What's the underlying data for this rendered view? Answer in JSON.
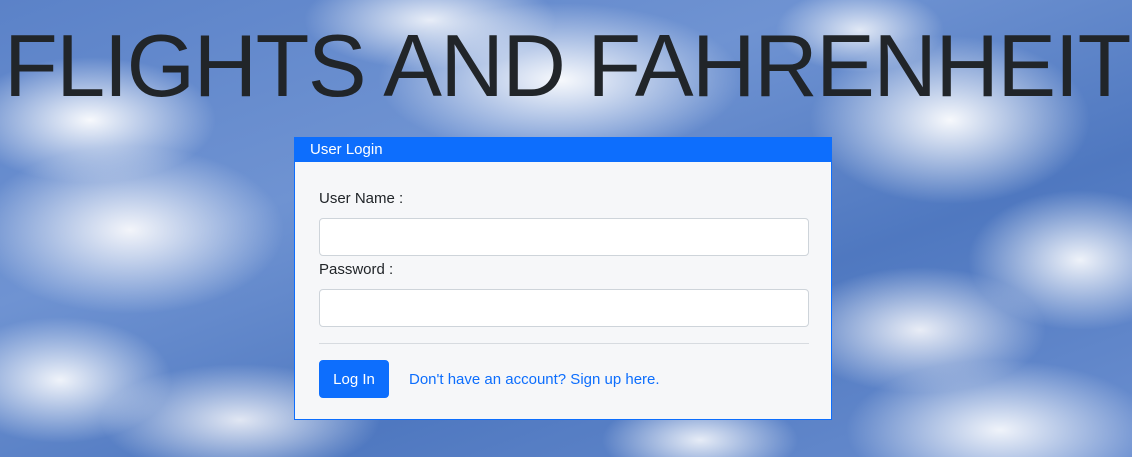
{
  "page": {
    "title": "FLIGHTS AND FAHRENHEIT"
  },
  "login_card": {
    "header": "User Login",
    "username_label": "User Name :",
    "username_value": "",
    "password_label": "Password :",
    "password_value": "",
    "login_button": "Log In",
    "signup_link": "Don't have an account? Sign up here."
  },
  "colors": {
    "accent": "#0d6efd",
    "title_text": "#212529",
    "card_background": "#f6f7f9",
    "sky_background": "#5b82c8"
  }
}
